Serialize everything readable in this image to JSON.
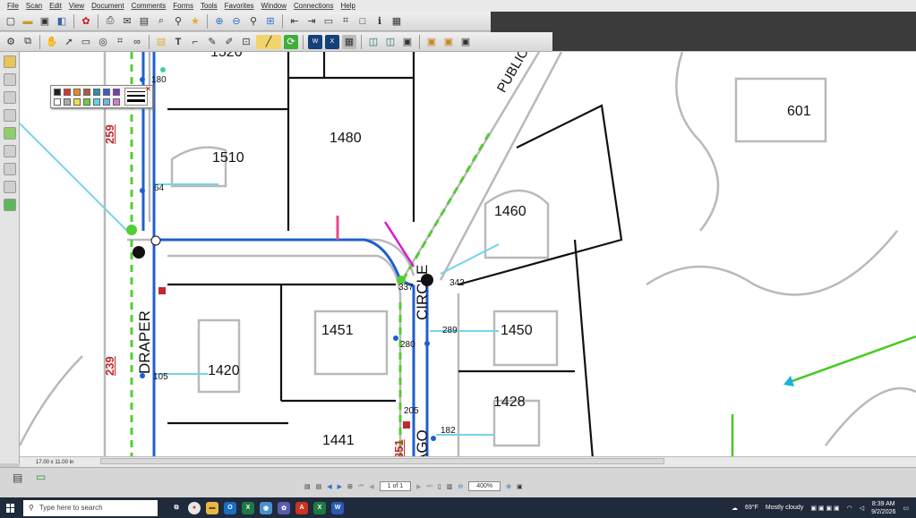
{
  "menu": [
    "File",
    "Scan",
    "Edit",
    "View",
    "Document",
    "Comments",
    "Forms",
    "Tools",
    "Favorites",
    "Window",
    "Connections",
    "Help"
  ],
  "map": {
    "parcels": [
      "1520",
      "601",
      "1480",
      "1510",
      "1460",
      "1451",
      "1450",
      "1420",
      "1428",
      "1441"
    ],
    "streets": [
      "PUBLIC F",
      "DRAPER",
      "CIRCLE",
      "AGO"
    ],
    "route_labels": [
      "259",
      "239",
      "351"
    ],
    "node_labels": [
      "180",
      "64",
      "337",
      "342",
      "280",
      "289",
      "105",
      "205",
      "182"
    ]
  },
  "status": {
    "page_size": "17.00 x 11.00 in",
    "page_num": "1 of 1",
    "zoom": "400%"
  },
  "taskbar": {
    "search_placeholder": "Type here to search",
    "weather_temp": "69°F",
    "weather_text": "Mostly cloudy",
    "time": "8:39 AM",
    "date": "9/2/2026"
  },
  "colors": {
    "water_main": "#1f5fcf",
    "service_line": "#74d3ea",
    "route_label": "#c0282c",
    "green_line": "#44cc22"
  }
}
